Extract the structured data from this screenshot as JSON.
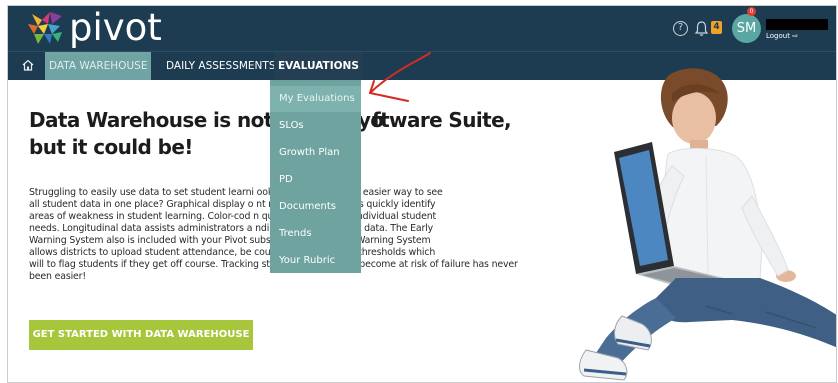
{
  "header": {
    "logo_text": "pivot",
    "help_glyph": "?",
    "notification_count": "4",
    "alert_count": "0",
    "avatar_initials": "SM",
    "logout_label": "Logout"
  },
  "nav": {
    "home_icon": "home-icon",
    "items": [
      {
        "label": "DATA WAREHOUSE"
      },
      {
        "label": "DAILY ASSESSMENTS"
      },
      {
        "label": "EVALUATIONS"
      }
    ]
  },
  "dropdown": {
    "items": [
      {
        "label": "My Evaluations"
      },
      {
        "label": "SLOs"
      },
      {
        "label": "Growth Plan"
      },
      {
        "label": "PD"
      },
      {
        "label": "Documents"
      },
      {
        "label": "Trends"
      },
      {
        "label": "Your Rubric"
      }
    ]
  },
  "content": {
    "heading_line1_a": "Data Warehouse is not part of yo",
    "heading_line1_b": "ftware Suite,",
    "heading_line2": "but it could be!",
    "paragraph_lines": [
      "Struggling to easily use data to set student learni                              ooking for a faster and easier way to see",
      "all student data in one place? Graphical display o                              nt results help teachers quickly identify",
      "areas of weakness in student learning. Color-cod                              n quick recognition of individual student",
      "needs. Longitudinal data assists administrators a                              nding trends in student data. The Early",
      "Warning System also is included with your Pivot                              subscription. The Early Warning System",
      "allows districts to upload student attendance, be                              course grades and set thresholds which",
      "will to flag students if they get off course. Tracking students before they become at risk of failure has never",
      "been easier!"
    ],
    "cta_label": "GET STARTED WITH DATA WAREHOUSE"
  },
  "colors": {
    "header_bg": "#1d3c52",
    "nav_active_bg": "#6fa3a4",
    "dropdown_bg": "#6fa3a0",
    "cta_bg": "#a8c63c",
    "badge_orange": "#f0a126",
    "annotation_red": "#d42b23"
  }
}
